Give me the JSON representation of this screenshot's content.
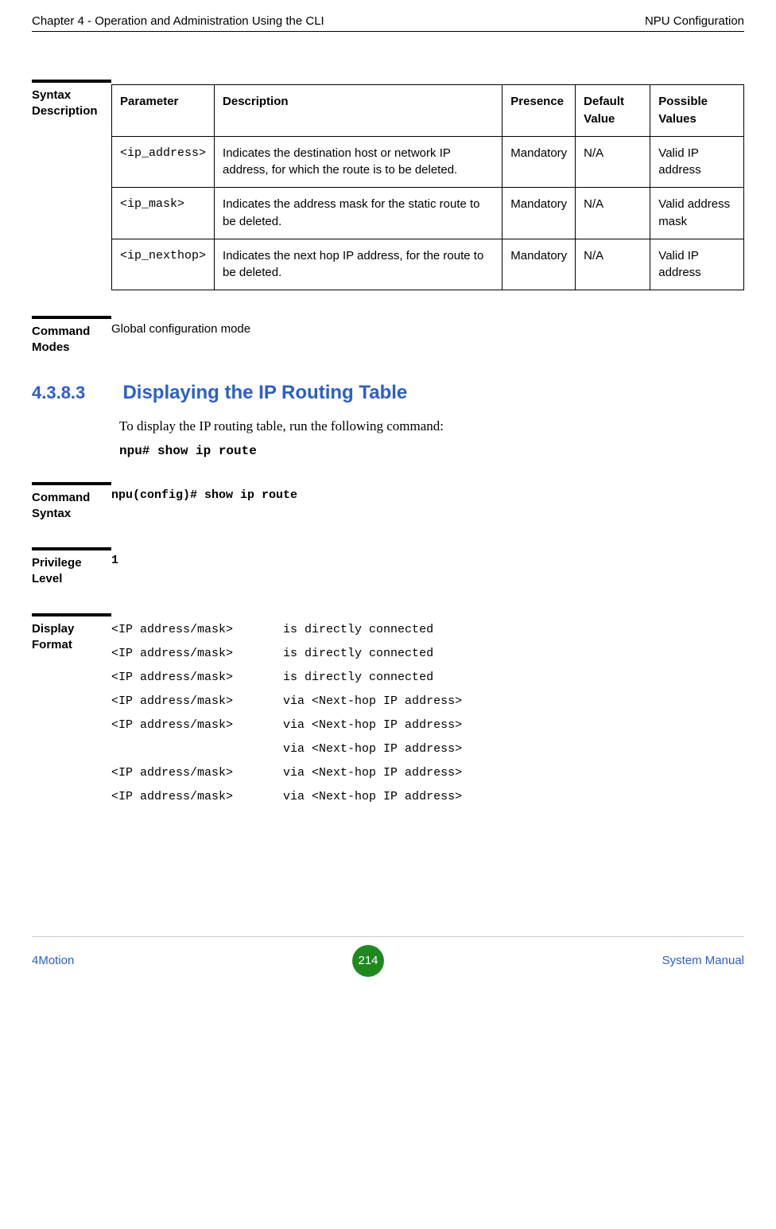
{
  "header": {
    "left": "Chapter 4 - Operation and Administration Using the CLI",
    "right": "NPU Configuration"
  },
  "syntax_description": {
    "label": "Syntax Description",
    "columns": [
      "Parameter",
      "Description",
      "Presence",
      "Default Value",
      "Possible Values"
    ],
    "rows": [
      {
        "parameter": "<ip_address>",
        "description": "Indicates the destination host or network IP address, for which the route is to be deleted.",
        "presence": "Mandatory",
        "default": "N/A",
        "possible": "Valid IP address"
      },
      {
        "parameter": "<ip_mask>",
        "description": "Indicates the address mask for the static route to be deleted.",
        "presence": "Mandatory",
        "default": "N/A",
        "possible": "Valid address mask"
      },
      {
        "parameter": "<ip_nexthop>",
        "description": "Indicates the next hop IP address, for the route to be deleted.",
        "presence": "Mandatory",
        "default": "N/A",
        "possible": "Valid IP address"
      }
    ]
  },
  "command_modes": {
    "label": "Command Modes",
    "value": "Global configuration mode"
  },
  "section": {
    "number": "4.3.8.3",
    "title": "Displaying the IP Routing Table",
    "body": "To display the IP routing table, run the following command:",
    "command": "npu# show ip route"
  },
  "command_syntax": {
    "label": "Command Syntax",
    "value": "npu(config)# show ip route"
  },
  "privilege_level": {
    "label": "Privilege Level",
    "value": "1"
  },
  "display_format": {
    "label": "Display Format",
    "lines": "<IP address/mask>       is directly connected\n<IP address/mask>       is directly connected\n<IP address/mask>       is directly connected\n<IP address/mask>       via <Next-hop IP address>\n<IP address/mask>       via <Next-hop IP address>\n                        via <Next-hop IP address>\n<IP address/mask>       via <Next-hop IP address>\n<IP address/mask>       via <Next-hop IP address>"
  },
  "footer": {
    "left": "4Motion",
    "page": "214",
    "right": "System Manual"
  }
}
